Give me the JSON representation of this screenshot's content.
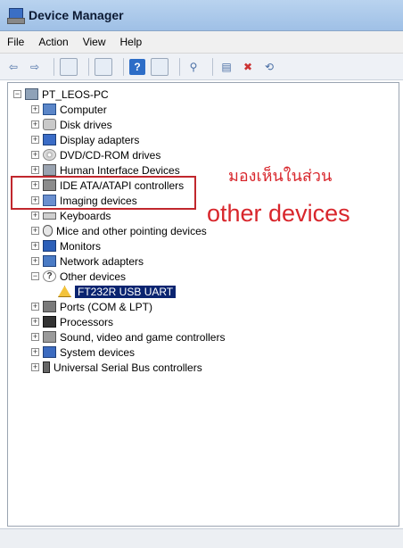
{
  "window": {
    "title": "Device Manager"
  },
  "menu": [
    "File",
    "Action",
    "View",
    "Help"
  ],
  "toolbar_icons": [
    "back-icon",
    "forward-icon",
    "console-tree-icon",
    "properties-icon",
    "help-icon",
    "view-icon",
    "scan-hardware-icon",
    "update-driver-icon",
    "disable-icon",
    "uninstall-icon"
  ],
  "tree": {
    "root": "PT_LEOS-PC",
    "items": [
      {
        "label": "Computer",
        "icon": "pc"
      },
      {
        "label": "Disk drives",
        "icon": "disk"
      },
      {
        "label": "Display adapters",
        "icon": "display"
      },
      {
        "label": "DVD/CD-ROM drives",
        "icon": "dvd"
      },
      {
        "label": "Human Interface Devices",
        "icon": "hid"
      },
      {
        "label": "IDE ATA/ATAPI controllers",
        "icon": "ide"
      },
      {
        "label": "Imaging devices",
        "icon": "img"
      },
      {
        "label": "Keyboards",
        "icon": "kbd"
      },
      {
        "label": "Mice and other pointing devices",
        "icon": "mouse"
      },
      {
        "label": "Monitors",
        "icon": "mon"
      },
      {
        "label": "Network adapters",
        "icon": "net"
      },
      {
        "label": "Other devices",
        "icon": "other",
        "expanded": true
      },
      {
        "label": "FT232R USB UART",
        "icon": "warn",
        "child": true,
        "selected": true
      },
      {
        "label": "Ports (COM & LPT)",
        "icon": "port"
      },
      {
        "label": "Processors",
        "icon": "cpu"
      },
      {
        "label": "Sound, video and game controllers",
        "icon": "sound"
      },
      {
        "label": "System devices",
        "icon": "sys"
      },
      {
        "label": "Universal Serial Bus controllers",
        "icon": "usb"
      }
    ]
  },
  "annotations": {
    "thai": "มองเห็นในส่วน",
    "english": "other devices"
  }
}
